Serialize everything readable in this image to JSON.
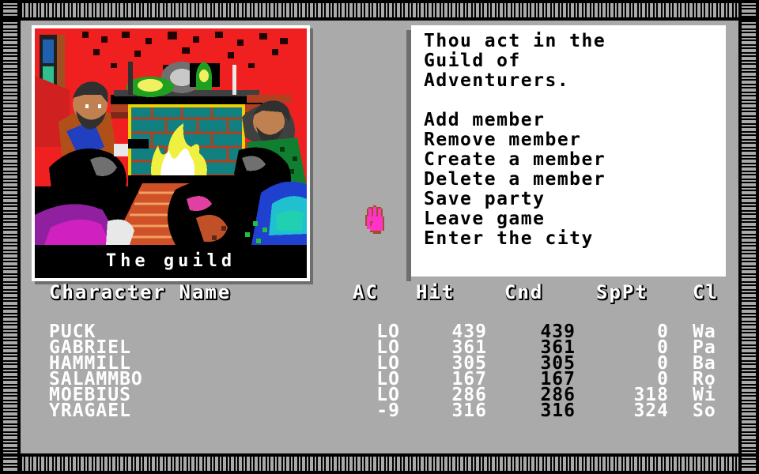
{
  "window": {
    "title": "Guild of Adventurers",
    "background_color": "#aaaaaa",
    "border_style": "x-chain-pixel-border"
  },
  "picture_panel": {
    "name": "guild-scene",
    "caption": "The guild",
    "frame_color": "#ffffff",
    "backdrop_color": "#000000"
  },
  "cursor": {
    "icon": "hand-cursor",
    "fill": "#ff33cc",
    "outline": "#a05020"
  },
  "text_panel": {
    "background": "#ffffff",
    "text_color": "#000000",
    "narration": [
      "Thou act in the",
      "Guild of",
      "Adventurers."
    ],
    "menu": [
      "Add member",
      "Remove member",
      "Create a member",
      "Delete a member",
      "Save party",
      "Leave game",
      "Enter the city"
    ]
  },
  "roster": {
    "headers": {
      "name": "Character Name",
      "ac": "AC",
      "hit": "Hit",
      "cnd": "Cnd",
      "sppt": "SpPt",
      "cl": "Cl"
    },
    "rows": [
      {
        "name": "PUCK",
        "ac": "LO",
        "hit": "439",
        "cnd": "439",
        "sppt": "0",
        "cl": "Wa"
      },
      {
        "name": "GABRIEL",
        "ac": "LO",
        "hit": "361",
        "cnd": "361",
        "sppt": "0",
        "cl": "Pa"
      },
      {
        "name": "HAMMILL",
        "ac": "LO",
        "hit": "305",
        "cnd": "305",
        "sppt": "0",
        "cl": "Ba"
      },
      {
        "name": "SALAMMBO",
        "ac": "LO",
        "hit": "167",
        "cnd": "167",
        "sppt": "0",
        "cl": "Ro"
      },
      {
        "name": "MOEBIUS",
        "ac": "LO",
        "hit": "286",
        "cnd": "286",
        "sppt": "318",
        "cl": "Wi"
      },
      {
        "name": "YRAGAEL",
        "ac": "-9",
        "hit": "316",
        "cnd": "316",
        "sppt": "324",
        "cl": "So"
      }
    ]
  }
}
